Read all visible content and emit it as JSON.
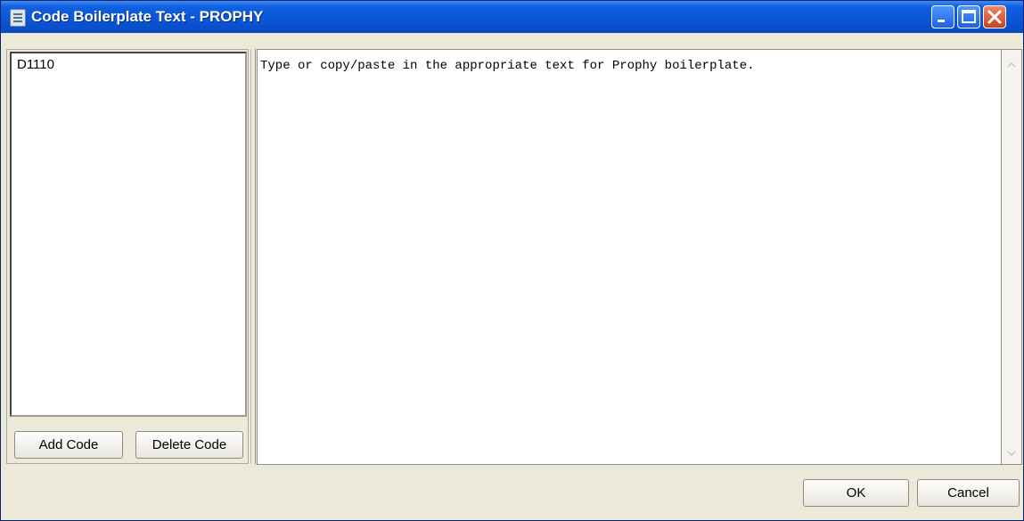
{
  "window": {
    "title": "Code Boilerplate Text - PROPHY"
  },
  "codes": {
    "items": [
      "D1110"
    ],
    "add_label": "Add Code",
    "delete_label": "Delete Code"
  },
  "editor": {
    "text": "Type or copy/paste in the appropriate text for Prophy boilerplate."
  },
  "footer": {
    "ok_label": "OK",
    "cancel_label": "Cancel"
  },
  "icons": {
    "app": "notepad-icon",
    "minimize": "minimize-icon",
    "maximize": "maximize-icon",
    "close": "close-icon",
    "scroll_up": "scroll-up-arrow-icon",
    "scroll_down": "scroll-down-arrow-icon"
  },
  "colors": {
    "titlebar": "#0a55d8",
    "close_button": "#c9401f",
    "window_face": "#ece9d8"
  }
}
